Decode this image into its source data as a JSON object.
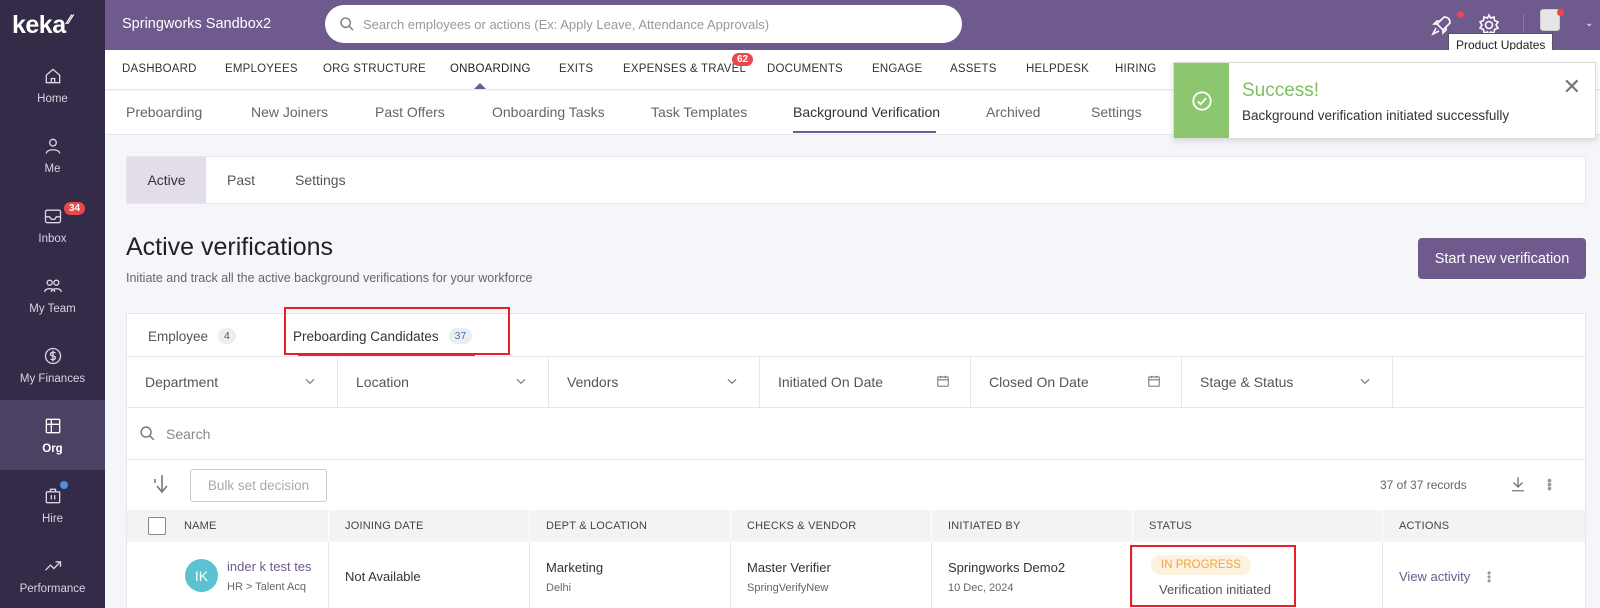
{
  "brand": {
    "logo": "keka"
  },
  "sidebar": {
    "items": [
      {
        "label": "Home",
        "icon": "home-icon"
      },
      {
        "label": "Me",
        "icon": "user-icon"
      },
      {
        "label": "Inbox",
        "icon": "inbox-icon",
        "badge": "34"
      },
      {
        "label": "My Team",
        "icon": "team-icon"
      },
      {
        "label": "My Finances",
        "icon": "finances-icon"
      },
      {
        "label": "Org",
        "icon": "org-icon",
        "active": true
      },
      {
        "label": "Hire",
        "icon": "briefcase-icon"
      },
      {
        "label": "Performance",
        "icon": "trend-icon"
      }
    ]
  },
  "header": {
    "org_name": "Springworks Sandbox2",
    "search_placeholder": "Search employees or actions (Ex: Apply Leave, Attendance Approvals)",
    "tooltip": "Product Updates"
  },
  "main_nav": {
    "items": [
      "DASHBOARD",
      "EMPLOYEES",
      "ORG STRUCTURE",
      "ONBOARDING",
      "EXITS",
      "EXPENSES & TRAVEL",
      "DOCUMENTS",
      "ENGAGE",
      "ASSETS",
      "HELPDESK",
      "HIRING"
    ],
    "active": "ONBOARDING",
    "expenses_badge": "62"
  },
  "sub_nav": {
    "items": [
      "Preboarding",
      "New Joiners",
      "Past Offers",
      "Onboarding Tasks",
      "Task Templates",
      "Background Verification",
      "Archived",
      "Settings"
    ],
    "active": "Background Verification"
  },
  "toast": {
    "title": "Success!",
    "message": "Background verification initiated successfully"
  },
  "verification_tabs": {
    "items": [
      "Active",
      "Past",
      "Settings"
    ],
    "active": "Active"
  },
  "page": {
    "title": "Active verifications",
    "subtitle": "Initiate and track all the active background verifications for your workforce",
    "start_button": "Start new verification"
  },
  "candidate_tabs": [
    {
      "label": "Employee",
      "count": "4"
    },
    {
      "label": "Preboarding Candidates",
      "count": "37",
      "active": true
    }
  ],
  "filters": [
    "Department",
    "Location",
    "Vendors",
    "Initiated On Date",
    "Closed On Date",
    "Stage & Status"
  ],
  "table_search_placeholder": "Search",
  "toolbar": {
    "bulk_label": "Bulk set decision",
    "records": "37 of 37 records"
  },
  "table": {
    "columns": [
      "NAME",
      "JOINING DATE",
      "DEPT & LOCATION",
      "CHECKS & VENDOR",
      "INITIATED BY",
      "STATUS",
      "ACTIONS"
    ],
    "rows": [
      {
        "initials": "IK",
        "name": "inder k test tes",
        "name_sub": "HR > Talent Acq",
        "joining_date": "Not Available",
        "dept": "Marketing",
        "location": "Delhi",
        "checks": "Master Verifier",
        "vendor": "SpringVerifyNew",
        "initiated_by": "Springworks Demo2",
        "initiated_on": "10 Dec, 2024",
        "status": "IN PROGRESS",
        "status_sub": "Verification initiated",
        "action": "View activity"
      }
    ]
  },
  "colors": {
    "brand_purple": "#6e5a8d",
    "sidebar_bg": "#332b48",
    "success_green": "#8cc76f",
    "badge_red": "#e8474c",
    "highlight_red": "#e81e2a"
  }
}
